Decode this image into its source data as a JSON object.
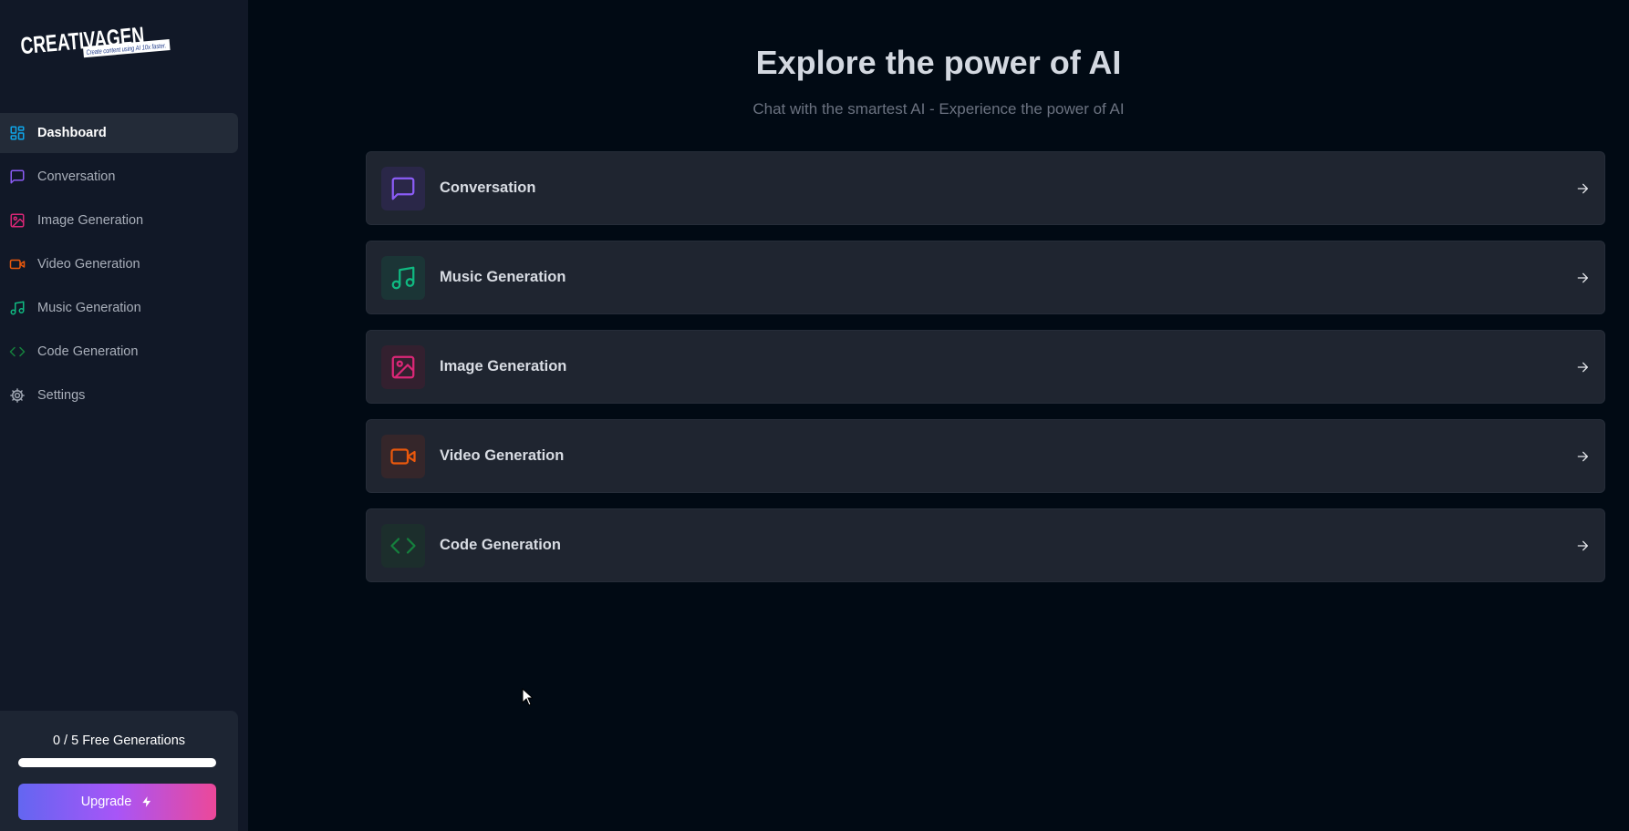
{
  "brand": {
    "name": "CREATIVAGEN",
    "tagline": "Create content using AI 10x faster."
  },
  "sidebar": {
    "items": [
      {
        "label": "Dashboard",
        "icon": "dashboard-icon",
        "color": "#0ea5e9",
        "active": true
      },
      {
        "label": "Conversation",
        "icon": "message-square-icon",
        "color": "#8b5cf6"
      },
      {
        "label": "Image Generation",
        "icon": "image-icon",
        "color": "#db2777"
      },
      {
        "label": "Video Generation",
        "icon": "video-icon",
        "color": "#ea580c"
      },
      {
        "label": "Music Generation",
        "icon": "music-icon",
        "color": "#10b981"
      },
      {
        "label": "Code Generation",
        "icon": "code-icon",
        "color": "#15803d"
      },
      {
        "label": "Settings",
        "icon": "settings-icon",
        "color": "#9ca3af"
      }
    ]
  },
  "quota": {
    "text": "0 / 5 Free Generations",
    "progress": 0,
    "upgrade_label": "Upgrade"
  },
  "main": {
    "title": "Explore the power of AI",
    "subtitle": "Chat with the smartest AI - Experience the power of AI",
    "cards": [
      {
        "label": "Conversation",
        "icon": "message-square-icon",
        "color": "#8b5cf6",
        "bg": "#2a2748"
      },
      {
        "label": "Music Generation",
        "icon": "music-icon",
        "color": "#10b981",
        "bg": "#1b3536"
      },
      {
        "label": "Image Generation",
        "icon": "image-icon",
        "color": "#db2777",
        "bg": "#33202f"
      },
      {
        "label": "Video Generation",
        "icon": "video-icon",
        "color": "#ea580c",
        "bg": "#35262a"
      },
      {
        "label": "Code Generation",
        "icon": "code-icon",
        "color": "#15803d",
        "bg": "#1c2e2c"
      }
    ]
  }
}
